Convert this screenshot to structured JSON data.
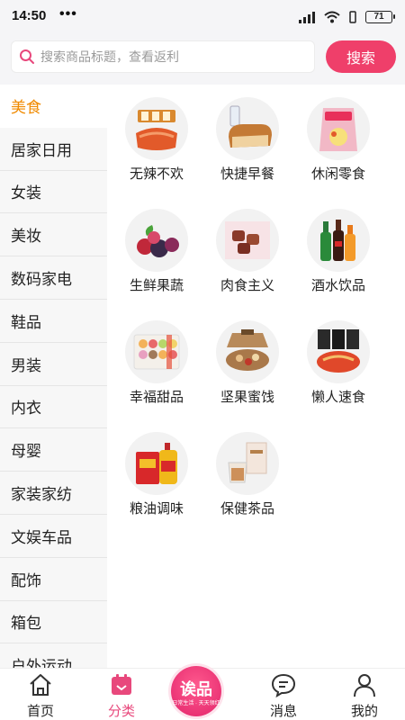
{
  "status_bar": {
    "time": "14:50",
    "dots": "•••",
    "battery": "71"
  },
  "search": {
    "placeholder": "搜索商品标题，查看返利",
    "button_label": "搜索"
  },
  "sidebar": {
    "items": [
      {
        "label": "美食",
        "active": true
      },
      {
        "label": "居家日用"
      },
      {
        "label": "女装"
      },
      {
        "label": "美妆"
      },
      {
        "label": "数码家电"
      },
      {
        "label": "鞋品"
      },
      {
        "label": "男装"
      },
      {
        "label": "内衣"
      },
      {
        "label": "母婴"
      },
      {
        "label": "家装家纺"
      },
      {
        "label": "文娱车品"
      },
      {
        "label": "配饰"
      },
      {
        "label": "箱包"
      },
      {
        "label": "户外运动"
      }
    ]
  },
  "categories": [
    {
      "label": "无辣不欢",
      "icon": "spicy-snack-image"
    },
    {
      "label": "快捷早餐",
      "icon": "bread-milk-image"
    },
    {
      "label": "休闲零食",
      "icon": "chips-bag-image"
    },
    {
      "label": "生鲜果蔬",
      "icon": "berries-image"
    },
    {
      "label": "肉食主义",
      "icon": "meat-snack-image"
    },
    {
      "label": "酒水饮品",
      "icon": "beverage-bottles-image"
    },
    {
      "label": "幸福甜品",
      "icon": "macaron-box-image"
    },
    {
      "label": "坚果蜜饯",
      "icon": "nuts-gift-box-image"
    },
    {
      "label": "懒人速食",
      "icon": "instant-noodles-image"
    },
    {
      "label": "粮油调味",
      "icon": "rice-oil-image"
    },
    {
      "label": "保健茶品",
      "icon": "tea-box-image"
    }
  ],
  "tabbar": {
    "items": [
      {
        "label": "首页",
        "icon": "home-icon"
      },
      {
        "label": "分类",
        "icon": "calendar-icon",
        "active": true
      },
      {
        "label": "消息",
        "icon": "chat-bubble-icon"
      },
      {
        "label": "我的",
        "icon": "person-icon"
      }
    ],
    "logo": {
      "main": "诶品",
      "sub": "日常生活 · 天天领红"
    }
  },
  "colors": {
    "accent": "#ef3f6a",
    "active_category": "#f08a00",
    "active_tab": "#e8487c"
  }
}
